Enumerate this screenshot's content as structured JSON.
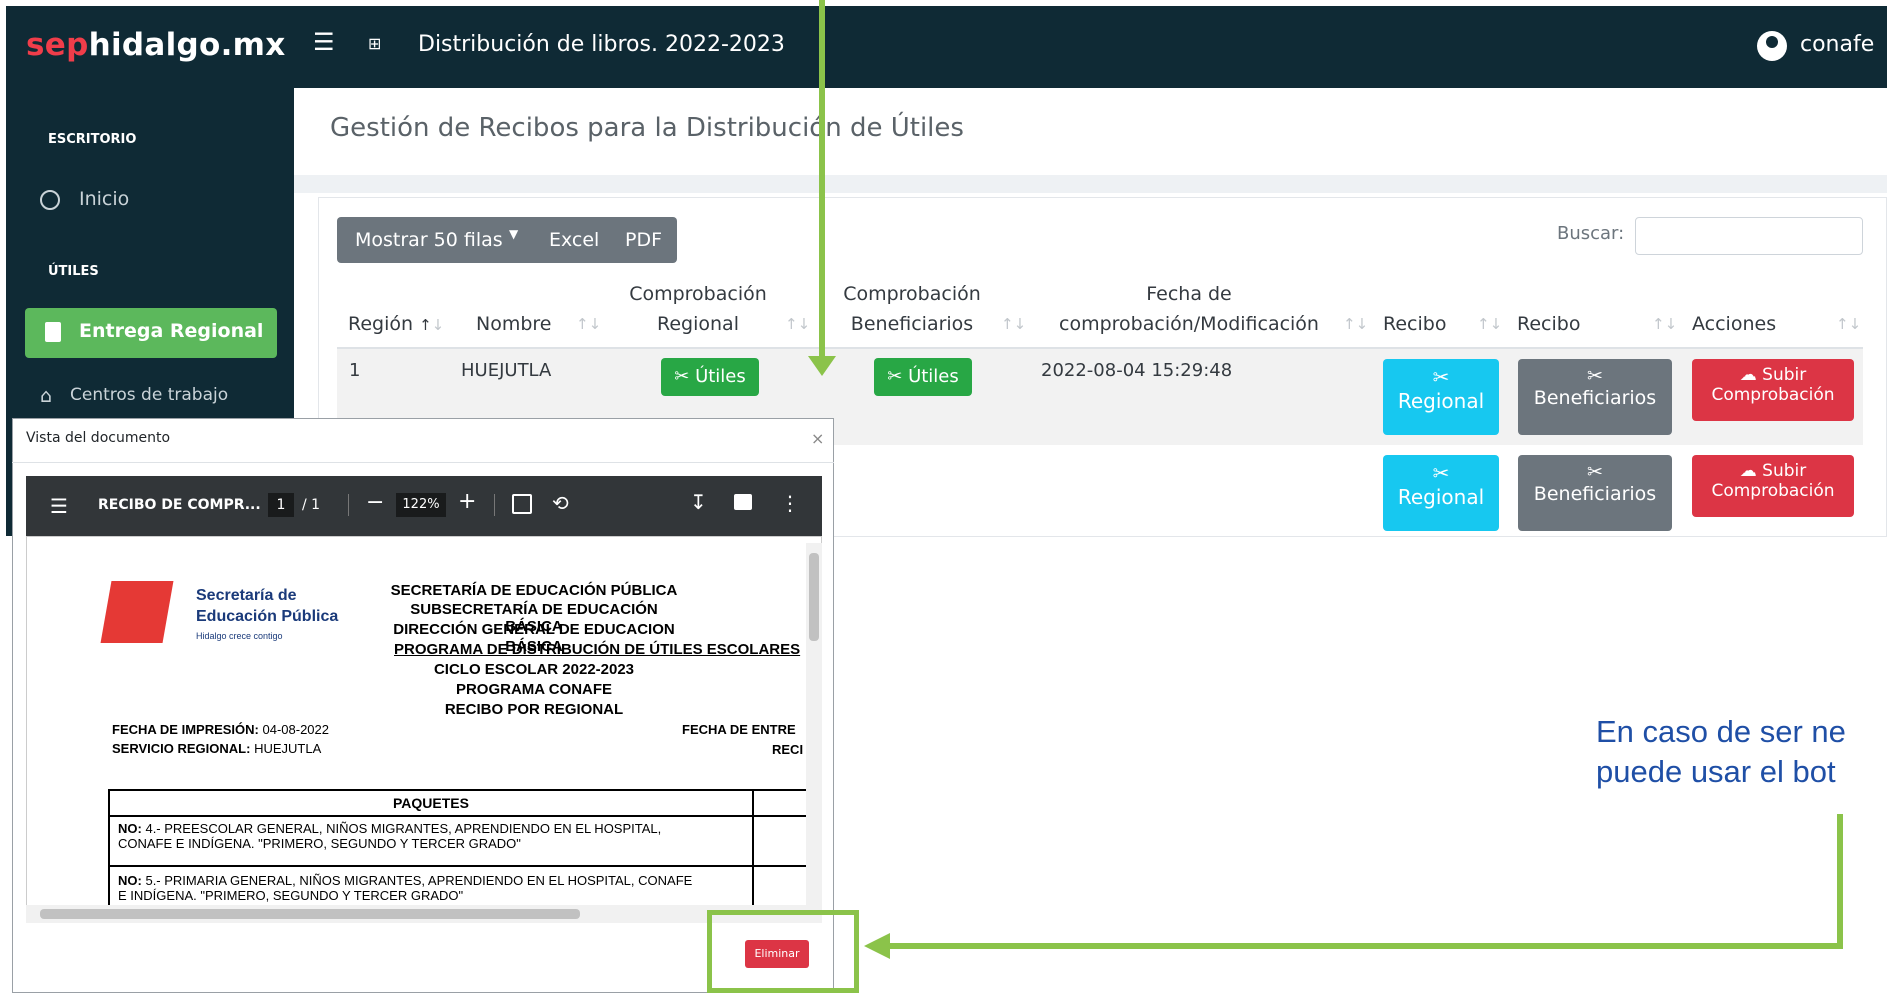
{
  "navbar": {
    "logo_prefix": "sep",
    "logo_rest": "hidalgo.mx",
    "menu_icon": "hamburger-icon",
    "app_title": "Distribución de libros. 2022-2023",
    "user_name": "conafe"
  },
  "sidebar": {
    "section_1": "ESCRITORIO",
    "inicio": "Inicio",
    "section_2": "ÚTILES",
    "active_item": "Entrega Regional",
    "centros": "Centros de trabajo"
  },
  "page": {
    "title": "Gestión de Recibos para la Distribución de Útiles",
    "rows_button": "Mostrar 50 filas",
    "excel_button": "Excel",
    "pdf_button": "PDF",
    "search_label": "Buscar:",
    "search_value": ""
  },
  "table": {
    "headers": {
      "region": "Región",
      "nombre": "Nombre",
      "comp_regional_1": "Comprobación",
      "comp_regional_2": "Regional",
      "comp_benef_1": "Comprobación",
      "comp_benef_2": "Beneficiarios",
      "fecha_1": "Fecha de",
      "fecha_2": "comprobación/Modificación",
      "recibo_1": "Recibo",
      "recibo_2": "Recibo",
      "acciones": "Acciones"
    },
    "row1": {
      "region": "1",
      "nombre": "HUEJUTLA",
      "btn_utiles": "Útiles",
      "fecha": "2022-08-04 15:29:48",
      "btn_regional": "Regional",
      "btn_beneficiarios": "Beneficiarios",
      "btn_subir_1": "Subir",
      "btn_subir_2": "Comprobación"
    },
    "row2": {
      "btn_regional": "Regional",
      "btn_beneficiarios": "Beneficiarios",
      "btn_subir_1": "Subir",
      "btn_subir_2": "Comprobación"
    }
  },
  "modal": {
    "title": "Vista del documento",
    "close": "×",
    "delete_button": "Eliminar",
    "pdf_toolbar": {
      "filename": "RECIBO DE COMPR...",
      "page_current": "1",
      "page_total": "/ 1",
      "zoom": "122%"
    },
    "document": {
      "org_1": "Secretaría de",
      "org_2": "Educación Pública",
      "org_3": "Hidalgo crece contigo",
      "line_1": "SECRETARÍA DE EDUCACIÓN PÚBLICA",
      "line_2": "SUBSECRETARÍA DE EDUCACIÓN BÁSICA",
      "line_3": "DIRECCIÓN GENERAL DE EDUCACION BÁSICA",
      "line_4": "PROGRAMA DE DISTRIBUCIÓN DE ÚTILES ESCOLARES",
      "line_5": "CICLO ESCOLAR 2022-2023",
      "line_6": "PROGRAMA CONAFE",
      "line_7": "RECIBO POR REGIONAL",
      "fecha_label": "FECHA DE IMPRESIÓN:",
      "fecha_value": "04-08-2022",
      "servicio_label": "SERVICIO REGIONAL:",
      "servicio_value": "HUEJUTLA",
      "fecha_entrega": "FECHA DE ENTRE",
      "reci": "RECI",
      "paquetes": "PAQUETES",
      "no_label": "NO:",
      "pkg_4_a": "4.- PREESCOLAR GENERAL, NIÑOS MIGRANTES, APRENDIENDO EN EL HOSPITAL,",
      "pkg_4_b": "CONAFE E INDÍGENA. \"PRIMERO, SEGUNDO Y TERCER GRADO\"",
      "pkg_5_a": "5.- PRIMARIA GENERAL, NIÑOS MIGRANTES, APRENDIENDO EN EL HOSPITAL, CONAFE",
      "pkg_5_b": "E INDÍGENA. \"PRIMERO, SEGUNDO Y TERCER GRADO\""
    }
  },
  "annotation": {
    "line_1": "En caso de ser ne",
    "line_2": "puede usar el bot"
  },
  "colors": {
    "navbar": "#0f2a35",
    "logo_accent": "#f03d4a",
    "active": "#5cb85c",
    "green_btn": "#28a745",
    "cyan_btn": "#17c8f0",
    "gray_btn": "#6c757d",
    "red_btn": "#dc3545",
    "annotation_line": "#8bc34a",
    "annotation_text": "#1f4fa6"
  }
}
